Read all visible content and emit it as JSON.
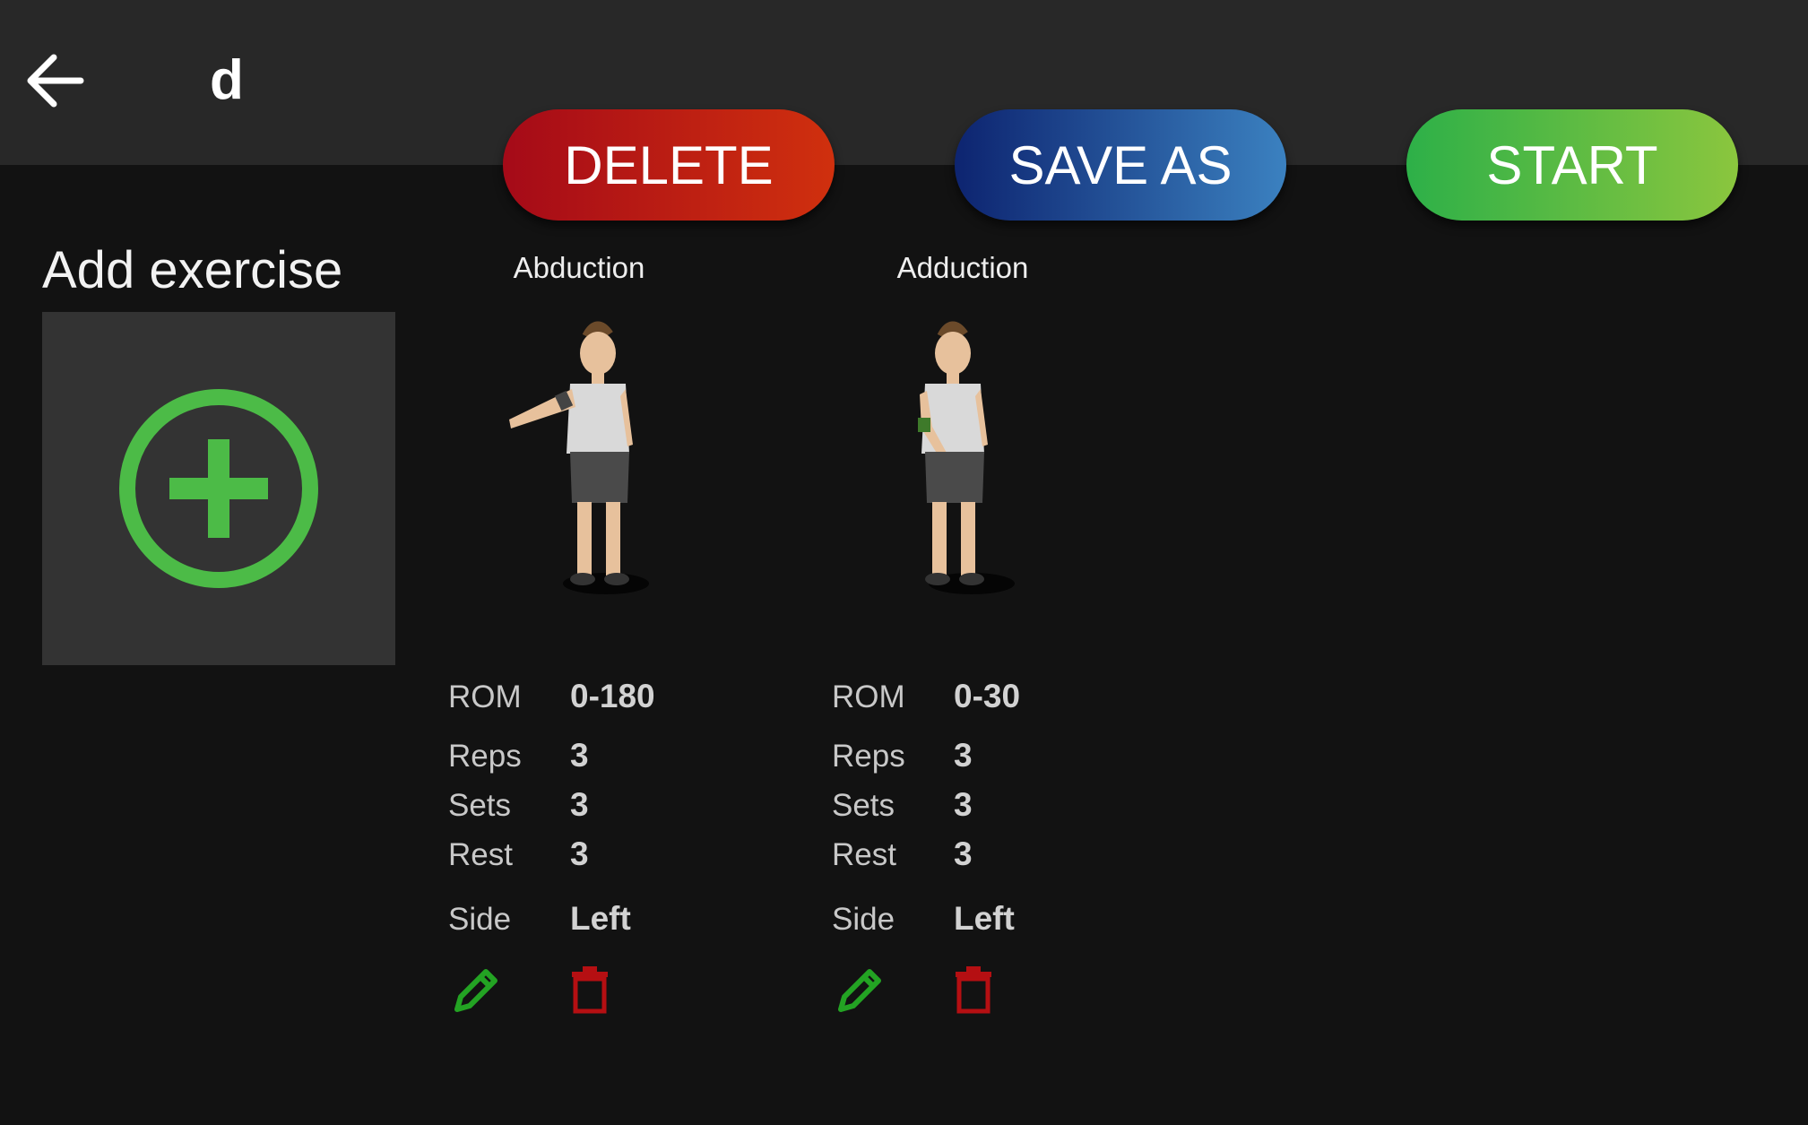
{
  "header": {
    "title": "d"
  },
  "actions": {
    "delete_label": "DELETE",
    "save_as_label": "SAVE AS",
    "start_label": "START"
  },
  "add_exercise": {
    "label": "Add exercise"
  },
  "exercises": [
    {
      "name": "Abduction",
      "fields": {
        "rom_label": "ROM",
        "rom": "0-180",
        "reps_label": "Reps",
        "reps": "3",
        "sets_label": "Sets",
        "sets": "3",
        "rest_label": "Rest",
        "rest": "3",
        "side_label": "Side",
        "side": "Left"
      }
    },
    {
      "name": "Adduction",
      "fields": {
        "rom_label": "ROM",
        "rom": "0-30",
        "reps_label": "Reps",
        "reps": "3",
        "sets_label": "Sets",
        "sets": "3",
        "rest_label": "Rest",
        "rest": "3",
        "side_label": "Side",
        "side": "Left"
      }
    }
  ],
  "icons": {
    "back": "arrow-left-icon",
    "add": "plus-circle-icon",
    "edit": "pencil-icon",
    "remove": "trash-icon"
  },
  "colors": {
    "delete": "#b81414",
    "save_as": "#1f4f98",
    "start": "#55b847",
    "add_green": "#4cbb47",
    "edit_green": "#23a323",
    "trash_red": "#b50f12"
  }
}
